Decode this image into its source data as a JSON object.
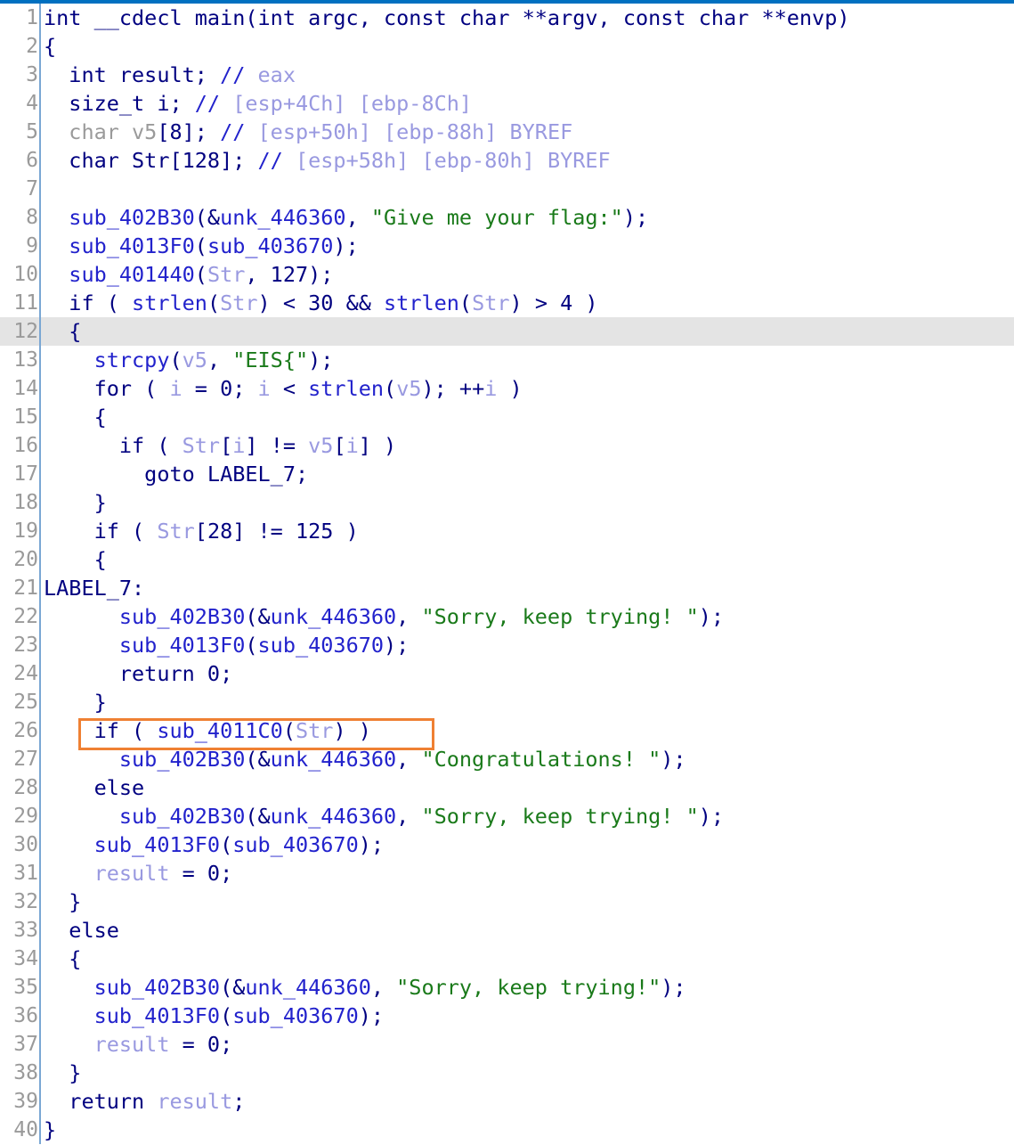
{
  "window": {
    "title": "Pseudocode-A",
    "accent_color": "#0070c0",
    "current_line": 12,
    "total_lines": 40
  },
  "theme": {
    "background": "#ffffff",
    "gutter_text": "#9a9a9a",
    "gutter_separator": "#7aa7d4",
    "current_line_background": "#e4e4e4",
    "keyword": "#000080",
    "function": "#2222cc",
    "string": "#1a7a1a",
    "variable": "#9999e0",
    "dimmed": "#9a9a9a",
    "comment": "#9999e0",
    "highlight_box": "#ef8033"
  },
  "annotation": {
    "name": "highlight-box",
    "target_line": 26,
    "target_text": "if ( sub_4011C0(Str) )",
    "color": "#ef8033"
  },
  "lines": [
    {
      "n": "1",
      "tokens": [
        {
          "t": "int __cdecl ",
          "c": "k"
        },
        {
          "t": "main",
          "c": "k"
        },
        {
          "t": "(int argc, const char **argv, const char **envp)",
          "c": "k"
        }
      ]
    },
    {
      "n": "2",
      "tokens": [
        {
          "t": "{",
          "c": "k"
        }
      ]
    },
    {
      "n": "3",
      "tokens": [
        {
          "t": "  int result; ",
          "c": "k"
        },
        {
          "t": "//",
          "c": "cmtslash"
        },
        {
          "t": " eax",
          "c": "cmt"
        }
      ]
    },
    {
      "n": "4",
      "tokens": [
        {
          "t": "  size_t i; ",
          "c": "k"
        },
        {
          "t": "//",
          "c": "cmtslash"
        },
        {
          "t": " [esp+4Ch] [ebp-8Ch]",
          "c": "cmt"
        }
      ]
    },
    {
      "n": "5",
      "tokens": [
        {
          "t": "  char v5",
          "c": "dim"
        },
        {
          "t": "[8]; ",
          "c": "k"
        },
        {
          "t": "//",
          "c": "cmtslash"
        },
        {
          "t": " [esp+50h] [ebp-88h] BYREF",
          "c": "cmt"
        }
      ]
    },
    {
      "n": "6",
      "tokens": [
        {
          "t": "  char Str[128]; ",
          "c": "k"
        },
        {
          "t": "//",
          "c": "cmtslash"
        },
        {
          "t": " [esp+58h] [ebp-80h] BYREF",
          "c": "cmt"
        }
      ]
    },
    {
      "n": "7",
      "tokens": [
        {
          "t": "",
          "c": "k"
        }
      ]
    },
    {
      "n": "8",
      "tokens": [
        {
          "t": "  ",
          "c": "k"
        },
        {
          "t": "sub_402B30",
          "c": "fn"
        },
        {
          "t": "(&",
          "c": "k"
        },
        {
          "t": "unk_446360",
          "c": "fn"
        },
        {
          "t": ", ",
          "c": "k"
        },
        {
          "t": "\"Give me your flag:\"",
          "c": "str"
        },
        {
          "t": ");",
          "c": "k"
        }
      ]
    },
    {
      "n": "9",
      "tokens": [
        {
          "t": "  ",
          "c": "k"
        },
        {
          "t": "sub_4013F0",
          "c": "fn"
        },
        {
          "t": "(",
          "c": "k"
        },
        {
          "t": "sub_403670",
          "c": "fn"
        },
        {
          "t": ");",
          "c": "k"
        }
      ]
    },
    {
      "n": "10",
      "tokens": [
        {
          "t": "  ",
          "c": "k"
        },
        {
          "t": "sub_401440",
          "c": "fn"
        },
        {
          "t": "(",
          "c": "k"
        },
        {
          "t": "Str",
          "c": "var"
        },
        {
          "t": ", 127);",
          "c": "k"
        }
      ]
    },
    {
      "n": "11",
      "tokens": [
        {
          "t": "  if ( ",
          "c": "k"
        },
        {
          "t": "strlen",
          "c": "fn"
        },
        {
          "t": "(",
          "c": "k"
        },
        {
          "t": "Str",
          "c": "var"
        },
        {
          "t": ") < 30 && ",
          "c": "k"
        },
        {
          "t": "strlen",
          "c": "fn"
        },
        {
          "t": "(",
          "c": "k"
        },
        {
          "t": "Str",
          "c": "var"
        },
        {
          "t": ") > 4 )",
          "c": "k"
        }
      ]
    },
    {
      "n": "12",
      "tokens": [
        {
          "t": "  {",
          "c": "k"
        }
      ],
      "current": true
    },
    {
      "n": "13",
      "tokens": [
        {
          "t": "    ",
          "c": "k"
        },
        {
          "t": "strcpy",
          "c": "fn"
        },
        {
          "t": "(",
          "c": "k"
        },
        {
          "t": "v5",
          "c": "var"
        },
        {
          "t": ", ",
          "c": "k"
        },
        {
          "t": "\"EIS{\"",
          "c": "str"
        },
        {
          "t": ");",
          "c": "k"
        }
      ]
    },
    {
      "n": "14",
      "tokens": [
        {
          "t": "    for ( ",
          "c": "k"
        },
        {
          "t": "i",
          "c": "var"
        },
        {
          "t": " = 0; ",
          "c": "k"
        },
        {
          "t": "i",
          "c": "var"
        },
        {
          "t": " < ",
          "c": "k"
        },
        {
          "t": "strlen",
          "c": "fn"
        },
        {
          "t": "(",
          "c": "k"
        },
        {
          "t": "v5",
          "c": "var"
        },
        {
          "t": "); ++",
          "c": "k"
        },
        {
          "t": "i",
          "c": "var"
        },
        {
          "t": " )",
          "c": "k"
        }
      ]
    },
    {
      "n": "15",
      "tokens": [
        {
          "t": "    {",
          "c": "k"
        }
      ]
    },
    {
      "n": "16",
      "tokens": [
        {
          "t": "      if ( ",
          "c": "k"
        },
        {
          "t": "Str",
          "c": "var"
        },
        {
          "t": "[",
          "c": "k"
        },
        {
          "t": "i",
          "c": "var"
        },
        {
          "t": "] != ",
          "c": "k"
        },
        {
          "t": "v5",
          "c": "var"
        },
        {
          "t": "[",
          "c": "k"
        },
        {
          "t": "i",
          "c": "var"
        },
        {
          "t": "] )",
          "c": "k"
        }
      ]
    },
    {
      "n": "17",
      "tokens": [
        {
          "t": "        goto LABEL_7;",
          "c": "k"
        }
      ]
    },
    {
      "n": "18",
      "tokens": [
        {
          "t": "    }",
          "c": "k"
        }
      ]
    },
    {
      "n": "19",
      "tokens": [
        {
          "t": "    if ( ",
          "c": "k"
        },
        {
          "t": "Str",
          "c": "var"
        },
        {
          "t": "[28] != 125 )",
          "c": "k"
        }
      ]
    },
    {
      "n": "20",
      "tokens": [
        {
          "t": "    {",
          "c": "k"
        }
      ]
    },
    {
      "n": "21",
      "tokens": [
        {
          "t": "LABEL_7:",
          "c": "lbl"
        }
      ]
    },
    {
      "n": "22",
      "tokens": [
        {
          "t": "      ",
          "c": "k"
        },
        {
          "t": "sub_402B30",
          "c": "fn"
        },
        {
          "t": "(&",
          "c": "k"
        },
        {
          "t": "unk_446360",
          "c": "fn"
        },
        {
          "t": ", ",
          "c": "k"
        },
        {
          "t": "\"Sorry, keep trying! \"",
          "c": "str"
        },
        {
          "t": ");",
          "c": "k"
        }
      ]
    },
    {
      "n": "23",
      "tokens": [
        {
          "t": "      ",
          "c": "k"
        },
        {
          "t": "sub_4013F0",
          "c": "fn"
        },
        {
          "t": "(",
          "c": "k"
        },
        {
          "t": "sub_403670",
          "c": "fn"
        },
        {
          "t": ");",
          "c": "k"
        }
      ]
    },
    {
      "n": "24",
      "tokens": [
        {
          "t": "      return 0;",
          "c": "k"
        }
      ]
    },
    {
      "n": "25",
      "tokens": [
        {
          "t": "    }",
          "c": "k"
        }
      ]
    },
    {
      "n": "26",
      "tokens": [
        {
          "t": "    if ( ",
          "c": "k"
        },
        {
          "t": "sub_4011C0",
          "c": "fn"
        },
        {
          "t": "(",
          "c": "k"
        },
        {
          "t": "Str",
          "c": "var"
        },
        {
          "t": ") )",
          "c": "k"
        }
      ]
    },
    {
      "n": "27",
      "tokens": [
        {
          "t": "      ",
          "c": "k"
        },
        {
          "t": "sub_402B30",
          "c": "fn"
        },
        {
          "t": "(&",
          "c": "k"
        },
        {
          "t": "unk_446360",
          "c": "fn"
        },
        {
          "t": ", ",
          "c": "k"
        },
        {
          "t": "\"Congratulations! \"",
          "c": "str"
        },
        {
          "t": ");",
          "c": "k"
        }
      ]
    },
    {
      "n": "28",
      "tokens": [
        {
          "t": "    else",
          "c": "k"
        }
      ]
    },
    {
      "n": "29",
      "tokens": [
        {
          "t": "      ",
          "c": "k"
        },
        {
          "t": "sub_402B30",
          "c": "fn"
        },
        {
          "t": "(&",
          "c": "k"
        },
        {
          "t": "unk_446360",
          "c": "fn"
        },
        {
          "t": ", ",
          "c": "k"
        },
        {
          "t": "\"Sorry, keep trying! \"",
          "c": "str"
        },
        {
          "t": ");",
          "c": "k"
        }
      ]
    },
    {
      "n": "30",
      "tokens": [
        {
          "t": "    ",
          "c": "k"
        },
        {
          "t": "sub_4013F0",
          "c": "fn"
        },
        {
          "t": "(",
          "c": "k"
        },
        {
          "t": "sub_403670",
          "c": "fn"
        },
        {
          "t": ");",
          "c": "k"
        }
      ]
    },
    {
      "n": "31",
      "tokens": [
        {
          "t": "    ",
          "c": "k"
        },
        {
          "t": "result",
          "c": "var"
        },
        {
          "t": " = 0;",
          "c": "k"
        }
      ]
    },
    {
      "n": "32",
      "tokens": [
        {
          "t": "  }",
          "c": "k"
        }
      ]
    },
    {
      "n": "33",
      "tokens": [
        {
          "t": "  else",
          "c": "k"
        }
      ]
    },
    {
      "n": "34",
      "tokens": [
        {
          "t": "  {",
          "c": "k"
        }
      ]
    },
    {
      "n": "35",
      "tokens": [
        {
          "t": "    ",
          "c": "k"
        },
        {
          "t": "sub_402B30",
          "c": "fn"
        },
        {
          "t": "(&",
          "c": "k"
        },
        {
          "t": "unk_446360",
          "c": "fn"
        },
        {
          "t": ", ",
          "c": "k"
        },
        {
          "t": "\"Sorry, keep trying!\"",
          "c": "str"
        },
        {
          "t": ");",
          "c": "k"
        }
      ]
    },
    {
      "n": "36",
      "tokens": [
        {
          "t": "    ",
          "c": "k"
        },
        {
          "t": "sub_4013F0",
          "c": "fn"
        },
        {
          "t": "(",
          "c": "k"
        },
        {
          "t": "sub_403670",
          "c": "fn"
        },
        {
          "t": ");",
          "c": "k"
        }
      ]
    },
    {
      "n": "37",
      "tokens": [
        {
          "t": "    ",
          "c": "k"
        },
        {
          "t": "result",
          "c": "var"
        },
        {
          "t": " = 0;",
          "c": "k"
        }
      ]
    },
    {
      "n": "38",
      "tokens": [
        {
          "t": "  }",
          "c": "k"
        }
      ]
    },
    {
      "n": "39",
      "tokens": [
        {
          "t": "  return ",
          "c": "k"
        },
        {
          "t": "result",
          "c": "var"
        },
        {
          "t": ";",
          "c": "k"
        }
      ]
    },
    {
      "n": "40",
      "tokens": [
        {
          "t": "}",
          "c": "k"
        }
      ]
    }
  ]
}
